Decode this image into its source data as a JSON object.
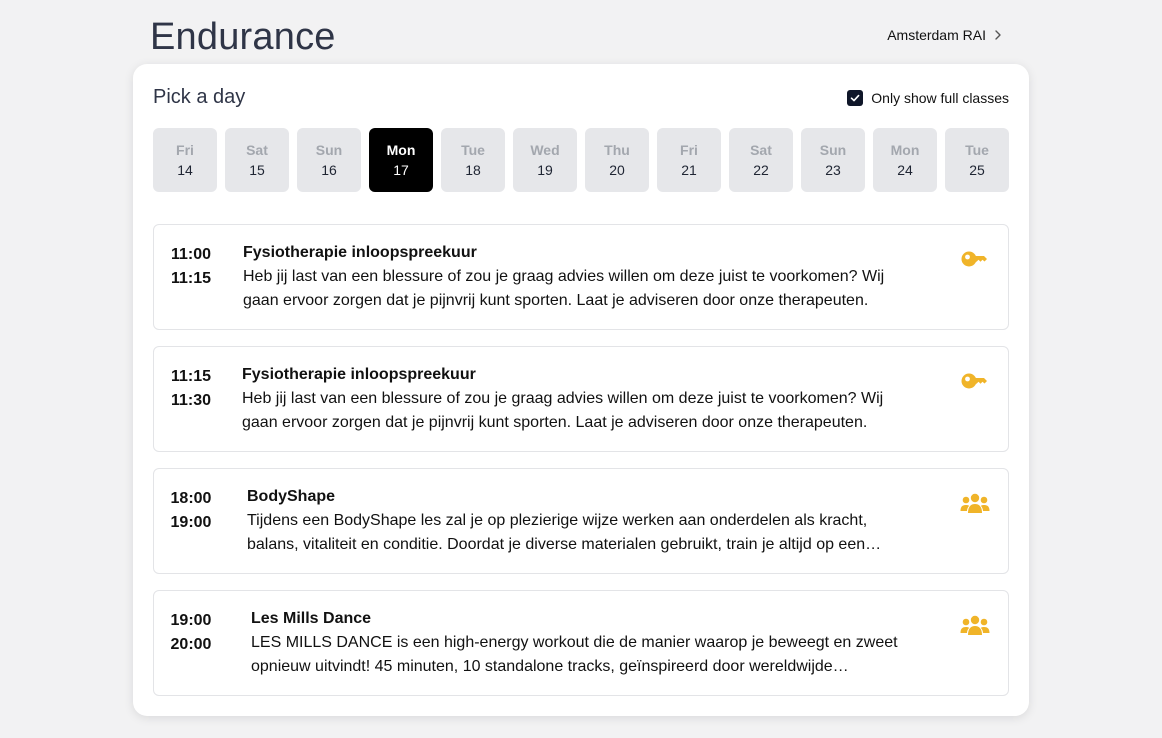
{
  "header": {
    "title": "Endurance",
    "location": "Amsterdam RAI"
  },
  "picker": {
    "title": "Pick a day",
    "filter_label": "Only show full classes",
    "filter_checked": true
  },
  "days": [
    {
      "name": "Fri",
      "num": "14",
      "selected": false
    },
    {
      "name": "Sat",
      "num": "15",
      "selected": false
    },
    {
      "name": "Sun",
      "num": "16",
      "selected": false
    },
    {
      "name": "Mon",
      "num": "17",
      "selected": true
    },
    {
      "name": "Tue",
      "num": "18",
      "selected": false
    },
    {
      "name": "Wed",
      "num": "19",
      "selected": false
    },
    {
      "name": "Thu",
      "num": "20",
      "selected": false
    },
    {
      "name": "Fri",
      "num": "21",
      "selected": false
    },
    {
      "name": "Sat",
      "num": "22",
      "selected": false
    },
    {
      "name": "Sun",
      "num": "23",
      "selected": false
    },
    {
      "name": "Mon",
      "num": "24",
      "selected": false
    },
    {
      "name": "Tue",
      "num": "25",
      "selected": false
    }
  ],
  "classes": [
    {
      "start": "11:00",
      "end": "11:15",
      "name": "Fysiotherapie inloopspreekuur",
      "desc_line1": "Heb jij last van een blessure of zou je graag advies willen om deze juist te voorkomen? Wij",
      "desc_line2": "gaan ervoor zorgen dat je pijnvrij kunt sporten. Laat je adviseren door onze therapeuten.",
      "icon": "key-icon"
    },
    {
      "start": "11:15",
      "end": "11:30",
      "name": "Fysiotherapie inloopspreekuur",
      "desc_line1": "Heb jij last van een blessure of zou je graag advies willen om deze juist te voorkomen? Wij",
      "desc_line2": "gaan ervoor zorgen dat je pijnvrij kunt sporten. Laat je adviseren door onze therapeuten.",
      "icon": "key-icon"
    },
    {
      "start": "18:00",
      "end": "19:00",
      "name": "BodyShape",
      "desc_line1": "Tijdens een BodyShape les zal je op plezierige wijze werken aan onderdelen als kracht,",
      "desc_line2": "balans, vitaliteit en conditie. Doordat je diverse materialen gebruikt, train je altijd op een…",
      "icon": "group-icon"
    },
    {
      "start": "19:00",
      "end": "20:00",
      "name": "Les Mills Dance",
      "desc_line1": "LES MILLS DANCE is een high-energy workout die de manier waarop je beweegt en zweet",
      "desc_line2": "opnieuw uitvindt! 45 minuten, 10 standalone tracks, geïnspireerd door wereldwijde…",
      "icon": "group-icon"
    }
  ],
  "colors": {
    "accent_icon": "#f0b429",
    "selected_day_bg": "#000000"
  }
}
